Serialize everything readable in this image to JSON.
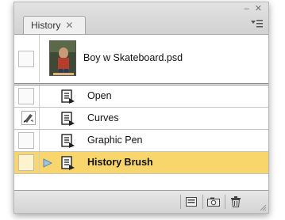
{
  "panel": {
    "tab_label": "History",
    "close_glyph": "✕",
    "window_controls": "– ✕"
  },
  "snapshot": {
    "name": "Boy w Skateboard.psd",
    "thumb_icon": "photo-thumbnail"
  },
  "states": [
    {
      "label": "Open",
      "icon": "history-state-icon",
      "brush_source": false,
      "selected": false
    },
    {
      "label": "Curves",
      "icon": "history-state-icon",
      "brush_source": true,
      "selected": false
    },
    {
      "label": "Graphic Pen",
      "icon": "history-state-icon",
      "brush_source": false,
      "selected": false
    },
    {
      "label": "History Brush",
      "icon": "history-state-icon",
      "brush_source": false,
      "selected": true
    }
  ],
  "bottom_buttons": [
    {
      "icon": "new-document-from-state-icon"
    },
    {
      "icon": "new-snapshot-icon"
    },
    {
      "icon": "trash-icon"
    }
  ],
  "colors": {
    "selected_row": "#f9d66b",
    "panel_bg": "#ececec"
  }
}
